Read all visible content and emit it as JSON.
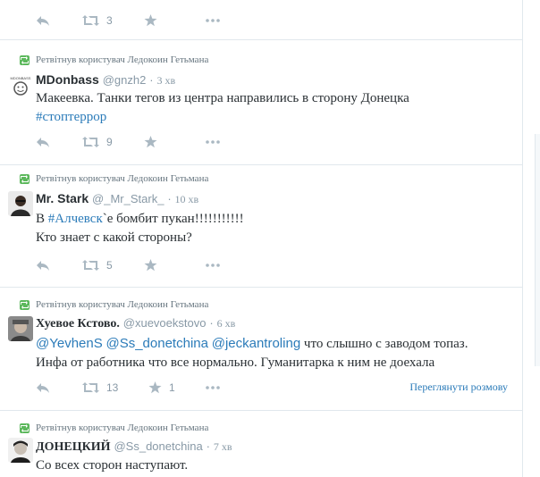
{
  "tweets": [
    {
      "retweet_label": "",
      "fullname": "",
      "handle": "",
      "time": "",
      "lines": [],
      "retweets": "3",
      "favorites": ""
    },
    {
      "retweet_label": "Ретвітнув користувач Ледокоин Гетьмана",
      "fullname": "MDonbass",
      "handle": "@gnzh2",
      "time": "3 хв",
      "line1": "Макеевка. Танки тегов из центра направились в сторону Донецка",
      "hashtag": "#стоптеррор",
      "retweets": "9",
      "favorites": ""
    },
    {
      "retweet_label": "Ретвітнув користувач Ледокоин Гетьмана",
      "fullname": "Mr. Stark",
      "handle": "@_Mr_Stark_",
      "time": "10 хв",
      "line1_pre": "В ",
      "line1_tag": "#Алчевск",
      "line1_post": "`е бомбит пукан!!!!!!!!!!!",
      "line2": "Кто знает с какой стороны?",
      "retweets": "5",
      "favorites": ""
    },
    {
      "retweet_label": "Ретвітнув користувач Ледокоин Гетьмана",
      "fullname": "Хуевое Кстово.",
      "handle": "@xuevoekstovo",
      "time": "6 хв",
      "mention1": "@YevhenS",
      "mention2": "@Ss_donetchina",
      "mention3": "@jeckantroling",
      "line1_post": " что слышно с заводом топаз.",
      "line2": "Инфа от работника что все нормально. Гуманитарка к ним не доехала",
      "retweets": "13",
      "favorites": "1",
      "conversation": "Переглянути розмову"
    },
    {
      "retweet_label": "Ретвітнув користувач Ледокоин Гетьмана",
      "fullname": "ДОНЕЦКИЙ",
      "handle": "@Ss_donetchina",
      "time": "7 хв",
      "line1": "Со всех сторон наступают."
    }
  ],
  "icons": {
    "reply": "reply-icon",
    "retweet": "retweet-icon",
    "favorite": "star-icon",
    "more": "more-icon",
    "retweeted_badge": "retweet-badge-icon"
  },
  "colors": {
    "link": "#2b7bb9",
    "muted": "#8899a6",
    "icon": "#aab8c2",
    "retweet_green": "#5cb85c"
  }
}
